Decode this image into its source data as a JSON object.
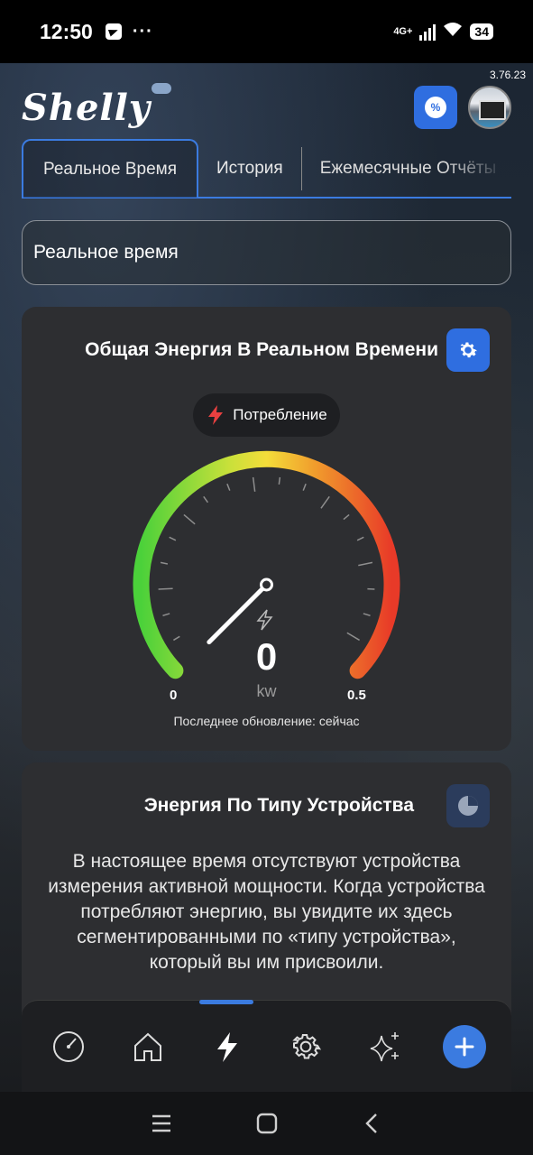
{
  "status_bar": {
    "time": "12:50",
    "dots": "···",
    "network": "4G+",
    "battery": "34"
  },
  "app": {
    "version": "3.76.23",
    "logo_text": "Shelly",
    "promo_badge": "%"
  },
  "tabs": [
    {
      "label": "Реальное Время",
      "active": true
    },
    {
      "label": "История",
      "active": false
    },
    {
      "label": "Ежемесячные Отчёты",
      "active": false
    }
  ],
  "section_header": "Реальное время",
  "realtime_card": {
    "title": "Общая Энергия В Реальном Времени",
    "chip_label": "Потребление",
    "gauge": {
      "value": 0,
      "value_text": "0",
      "unit": "kw",
      "min_label": "0",
      "max_label": "0.5",
      "min": 0,
      "max": 0.5
    },
    "last_update": "Последнее обновление: сейчас"
  },
  "device_card": {
    "title": "Энергия По Типу Устройства",
    "message": "В настоящее время отсутствуют устройства измерения активной мощности. Когда устройства потребляют энергию, вы увидите их здесь сегментированными по «типу устройства», который вы им присвоили."
  },
  "bottom_nav": [
    "gauge-icon",
    "home-icon",
    "lightning-icon",
    "gear-icon",
    "sparkle-icon",
    "add-icon"
  ],
  "colors": {
    "accent": "#3b7be0",
    "card": "#2d2e31"
  }
}
